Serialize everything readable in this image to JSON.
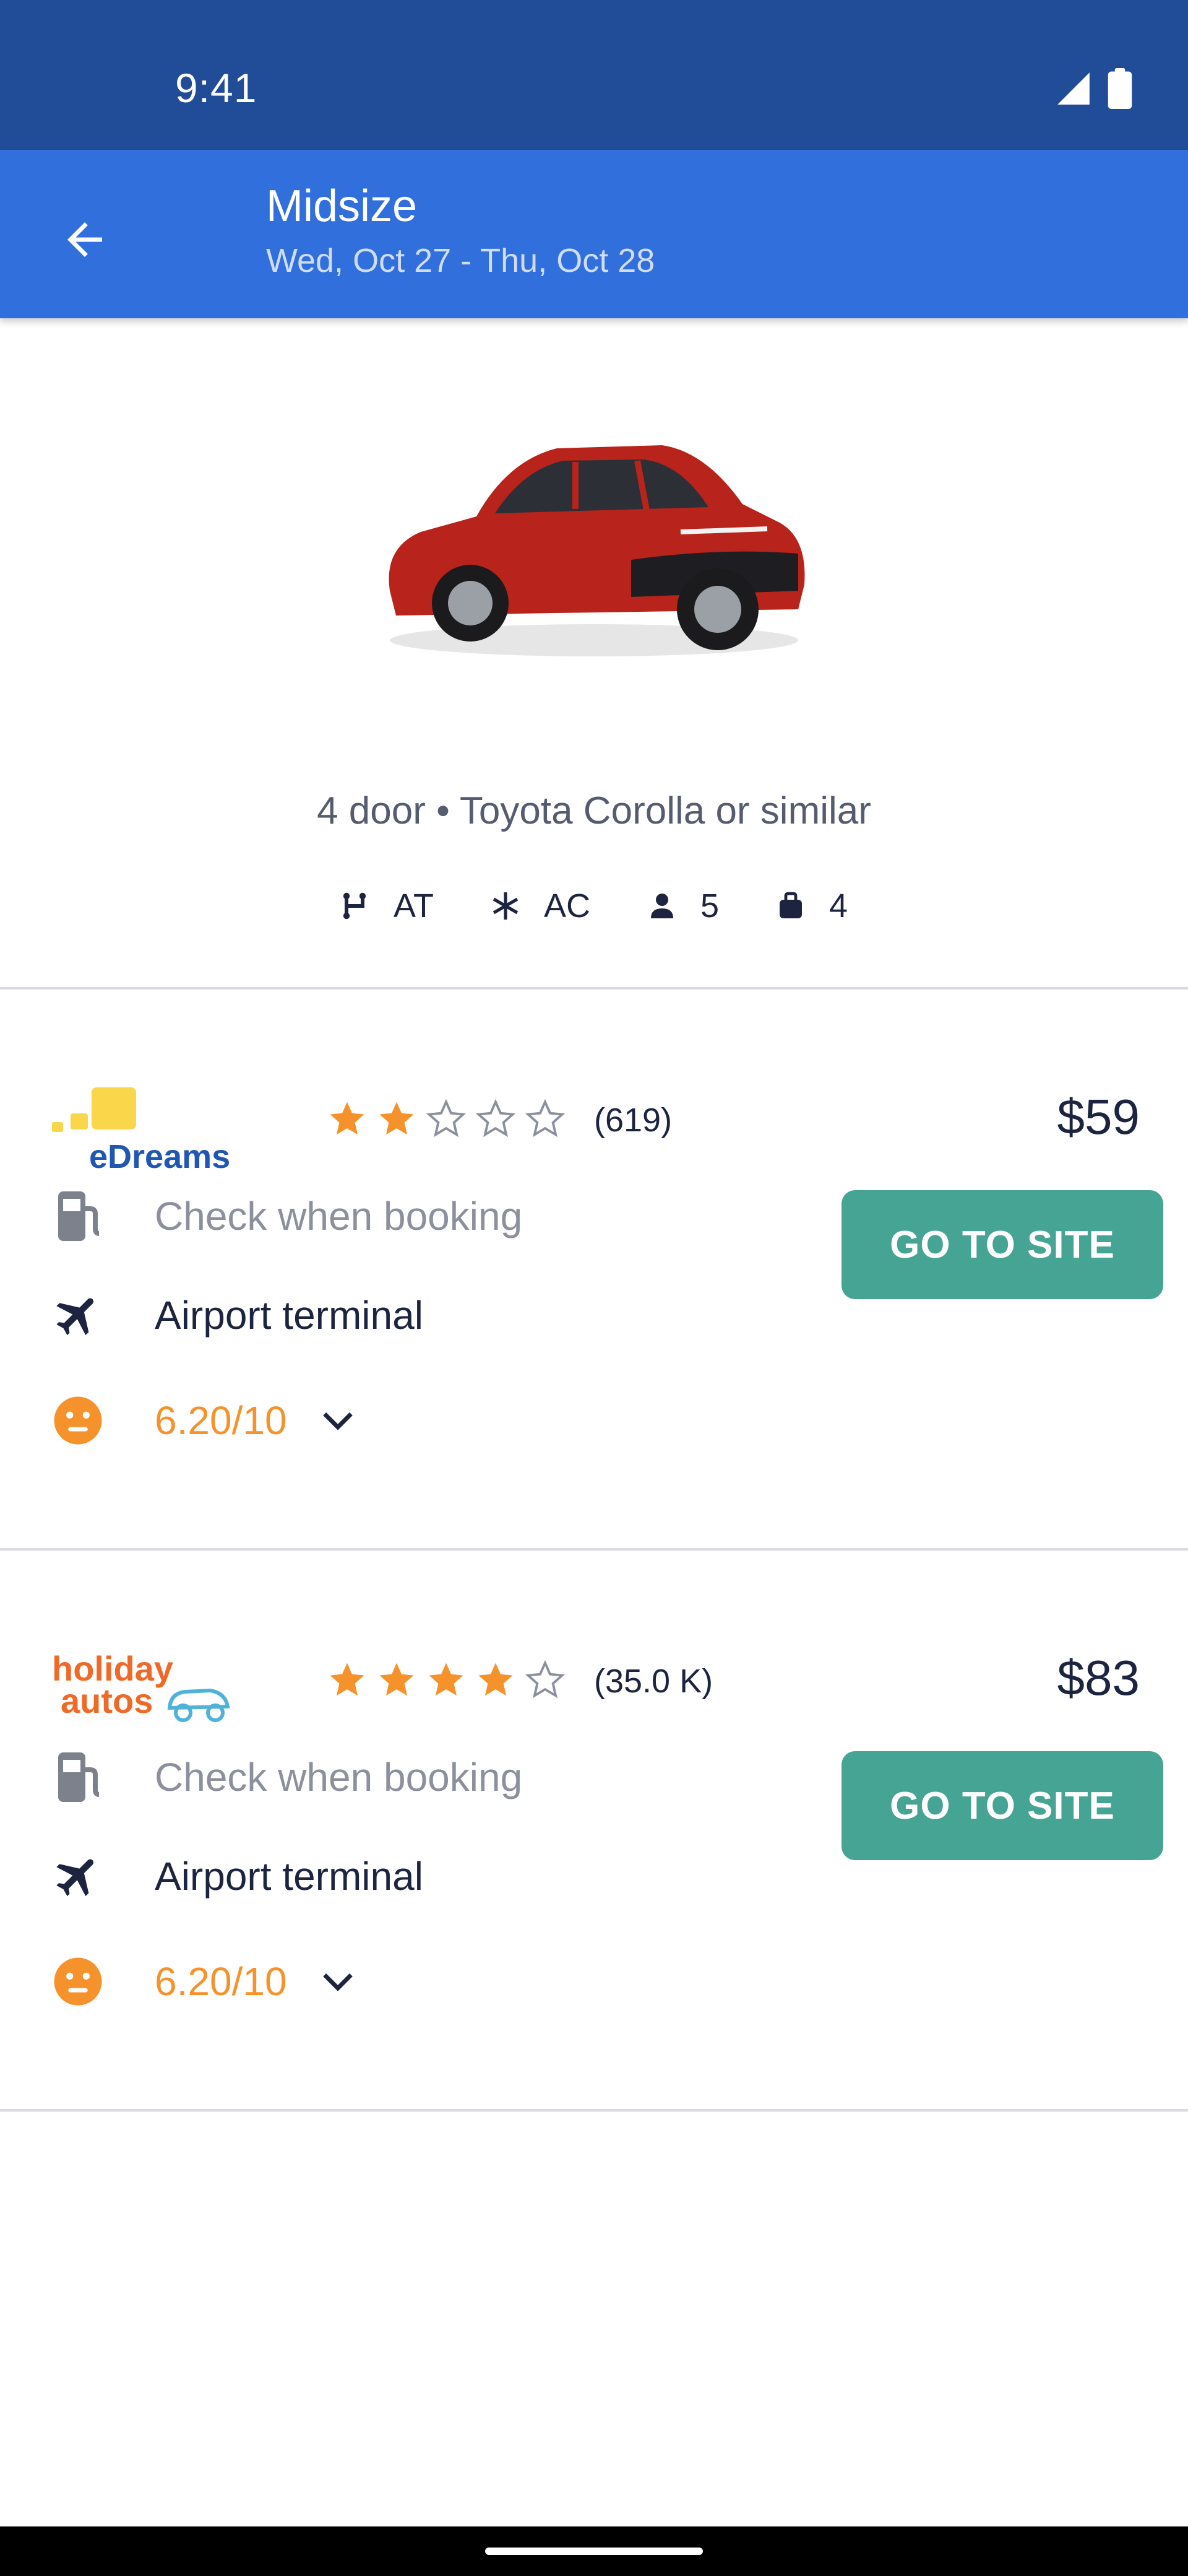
{
  "status": {
    "time": "9:41"
  },
  "header": {
    "title": "Midsize",
    "dates": "Wed, Oct 27 - Thu, Oct 28"
  },
  "car": {
    "description": "4 door • Toyota Corolla or similar",
    "specs": {
      "transmission": "AT",
      "ac": "AC",
      "seats": "5",
      "bags": "4"
    }
  },
  "deals": [
    {
      "provider": "eDreams",
      "rating": 2,
      "reviews": "(619)",
      "price": "$59",
      "fuel": "Check when booking",
      "location": "Airport terminal",
      "score": "6.20/10",
      "button": "GO TO SITE"
    },
    {
      "provider": "holiday autos",
      "rating": 4,
      "reviews": "(35.0 K)",
      "price": "$83",
      "fuel": "Check when booking",
      "location": "Airport terminal",
      "score": "6.20/10",
      "button": "GO TO SITE"
    }
  ],
  "colors": {
    "statusBar": "#214c97",
    "appBar": "#316fdc",
    "button": "#46a494",
    "star": "#f5922b"
  }
}
